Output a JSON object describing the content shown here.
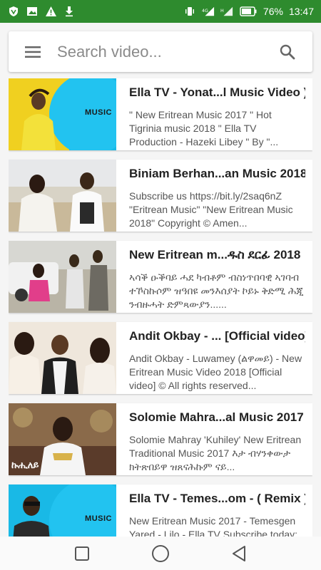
{
  "status_bar": {
    "left_icons": [
      "shield-icon",
      "image-icon",
      "warning-icon",
      "download-icon"
    ],
    "battery_percent": "76%",
    "time": "13:47"
  },
  "search": {
    "placeholder": "Search video...",
    "value": ""
  },
  "videos": [
    {
      "title": "Ella TV - Yonat...l Music Video )",
      "description": "\" New Eritrean Music 2017 \" Hot Tigrinia music 2018 \" Ella TV Production - Hazeki Libey \" By \"...",
      "thumb_label": "MUSIC"
    },
    {
      "title": "Biniam Berhan...an Music 2018",
      "description": "Subscribe us https://bit.ly/2saq6nZ \"Eritrean Music\" \"New Eritrean Music 2018\" Copyright © Amen...",
      "thumb_label": ""
    },
    {
      "title": "New Eritrean m...ዱስ ደርፊ 2018",
      "description": "ኣሳቕ ዑቕባይ ሓደ ካብቶም ብስነጥበባዊ ኣገባብ ተኾስኩሶም ዝዓበዩ መንእሰያት ኮይኑ ቅድሚ ሕጂ ንብዙሓት ድምጻውያን......",
      "thumb_label": ""
    },
    {
      "title": "Andit Okbay - ... [Official video]",
      "description": "Andit Okbay - Luwamey (ልዋመይ) - New Eritrean Music Video 2018 [Official video] © All rights reserved...",
      "thumb_label": ""
    },
    {
      "title": "Solomie Mahra...al Music 2017",
      "description": "Solomie Mahray 'Kuhiley' New Eritrean Traditional Music 2017 እታ ብሃንቀውታ ክትጽበይዋ ዝጸናሕኩም ናይ...",
      "thumb_label": "ኩሒለይ"
    },
    {
      "title": "Ella TV - Temes...om - ( Remix )",
      "description": "New Eritrean Music 2017 - Temesgen Yared - Lilo - Ella TV Subscribe today:",
      "thumb_label": "MUSIC"
    }
  ],
  "nav": {
    "buttons": [
      "recents-button",
      "home-button",
      "back-button"
    ]
  },
  "colors": {
    "status_bar": "#2e8b2e",
    "cyan": "#19b9e6",
    "yellow": "#f0d020"
  }
}
